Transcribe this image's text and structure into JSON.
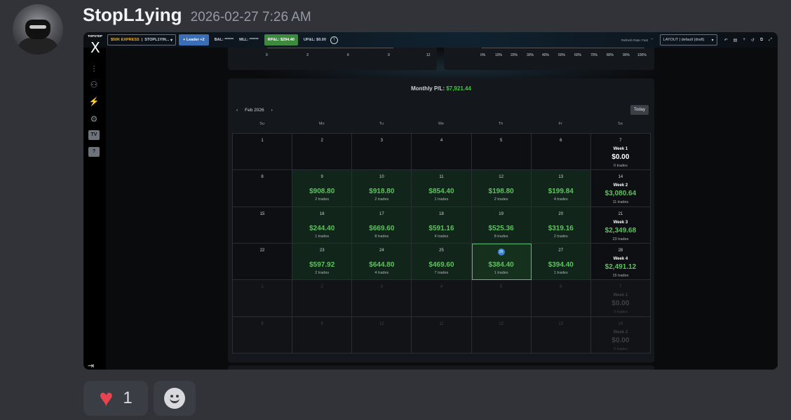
{
  "message": {
    "username": "StopL1ying",
    "timestamp": "2026-02-27 7:26 AM"
  },
  "toolbar": {
    "brand_small": "TOPSTEP",
    "account_type": "$50K EXPRESS",
    "account_name": "STOPL1YIN...",
    "leader_label": "+ Leader +2",
    "bal": "BAL: ******",
    "mll": "MLL: ******",
    "rpl": "RP&L: $294.40",
    "upl": "UP&L: $0.00",
    "refresh_rate": "Refresh Rate: Fast",
    "layout": "LAYOUT | default (draft)"
  },
  "top_axes": {
    "left_ticks": [
      "0",
      "3",
      "6",
      "9",
      "12"
    ],
    "right_ticks": [
      "0%",
      "10%",
      "20%",
      "30%",
      "40%",
      "50%",
      "60%",
      "70%",
      "80%",
      "90%",
      "100%"
    ]
  },
  "calendar": {
    "monthly_label": "Monthly P/L:",
    "monthly_value": "$7,921.44",
    "month": "Feb 2026",
    "today_label": "Today",
    "prev_icon": "‹",
    "next_icon": "›",
    "weekdays": [
      "Su",
      "Mo",
      "Tu",
      "We",
      "Th",
      "Fr",
      "Sa"
    ],
    "rows": [
      [
        {
          "d": "1"
        },
        {
          "d": "2"
        },
        {
          "d": "3"
        },
        {
          "d": "4"
        },
        {
          "d": "5"
        },
        {
          "d": "6"
        },
        {
          "d": "7",
          "week": "Week 1",
          "amt": "$0.00",
          "tr": "0 trades"
        }
      ],
      [
        {
          "d": "8"
        },
        {
          "d": "9",
          "amt": "$908.80",
          "tr": "2 trades"
        },
        {
          "d": "10",
          "amt": "$918.80",
          "tr": "2 trades"
        },
        {
          "d": "11",
          "amt": "$854.40",
          "tr": "1 trades"
        },
        {
          "d": "12",
          "amt": "$198.80",
          "tr": "2 trades"
        },
        {
          "d": "13",
          "amt": "$199.84",
          "tr": "4 trades"
        },
        {
          "d": "14",
          "week": "Week 2",
          "amt": "$3,080.64",
          "tr": "11 trades"
        }
      ],
      [
        {
          "d": "15"
        },
        {
          "d": "16",
          "amt": "$244.40",
          "tr": "1 trades"
        },
        {
          "d": "17",
          "amt": "$669.60",
          "tr": "8 trades"
        },
        {
          "d": "18",
          "amt": "$591.16",
          "tr": "4 trades"
        },
        {
          "d": "19",
          "amt": "$525.36",
          "tr": "8 trades"
        },
        {
          "d": "20",
          "amt": "$319.16",
          "tr": "2 trades"
        },
        {
          "d": "21",
          "week": "Week 3",
          "amt": "$2,349.68",
          "tr": "23 trades"
        }
      ],
      [
        {
          "d": "22"
        },
        {
          "d": "23",
          "amt": "$597.92",
          "tr": "2 trades"
        },
        {
          "d": "24",
          "amt": "$644.80",
          "tr": "4 trades"
        },
        {
          "d": "25",
          "amt": "$469.60",
          "tr": "7 trades"
        },
        {
          "d": "26",
          "amt": "$384.40",
          "tr": "1 trades",
          "today": true
        },
        {
          "d": "27",
          "amt": "$394.40",
          "tr": "1 trades"
        },
        {
          "d": "28",
          "week": "Week 4",
          "amt": "$2,491.12",
          "tr": "15 trades"
        }
      ],
      [
        {
          "d": "1",
          "faded": true
        },
        {
          "d": "2",
          "faded": true
        },
        {
          "d": "3",
          "faded": true
        },
        {
          "d": "4",
          "faded": true
        },
        {
          "d": "5",
          "faded": true
        },
        {
          "d": "6",
          "faded": true
        },
        {
          "d": "7",
          "faded": true,
          "week": "Week 1",
          "amt": "$0.00",
          "tr": "0 trades"
        }
      ],
      [
        {
          "d": "8",
          "faded": true
        },
        {
          "d": "9",
          "faded": true
        },
        {
          "d": "10",
          "faded": true
        },
        {
          "d": "11",
          "faded": true
        },
        {
          "d": "12",
          "faded": true
        },
        {
          "d": "13",
          "faded": true
        },
        {
          "d": "14",
          "faded": true,
          "week": "Week 2",
          "amt": "$0.00",
          "tr": "0 trades"
        }
      ]
    ]
  },
  "reactions": {
    "heart_count": "1"
  },
  "colors": {
    "profit_green": "#5cc35e",
    "brand_gold": "#e8b23b",
    "leader_blue": "#3a6fb8",
    "today_blue": "#3a85d8",
    "heart_red": "#e8434f"
  }
}
